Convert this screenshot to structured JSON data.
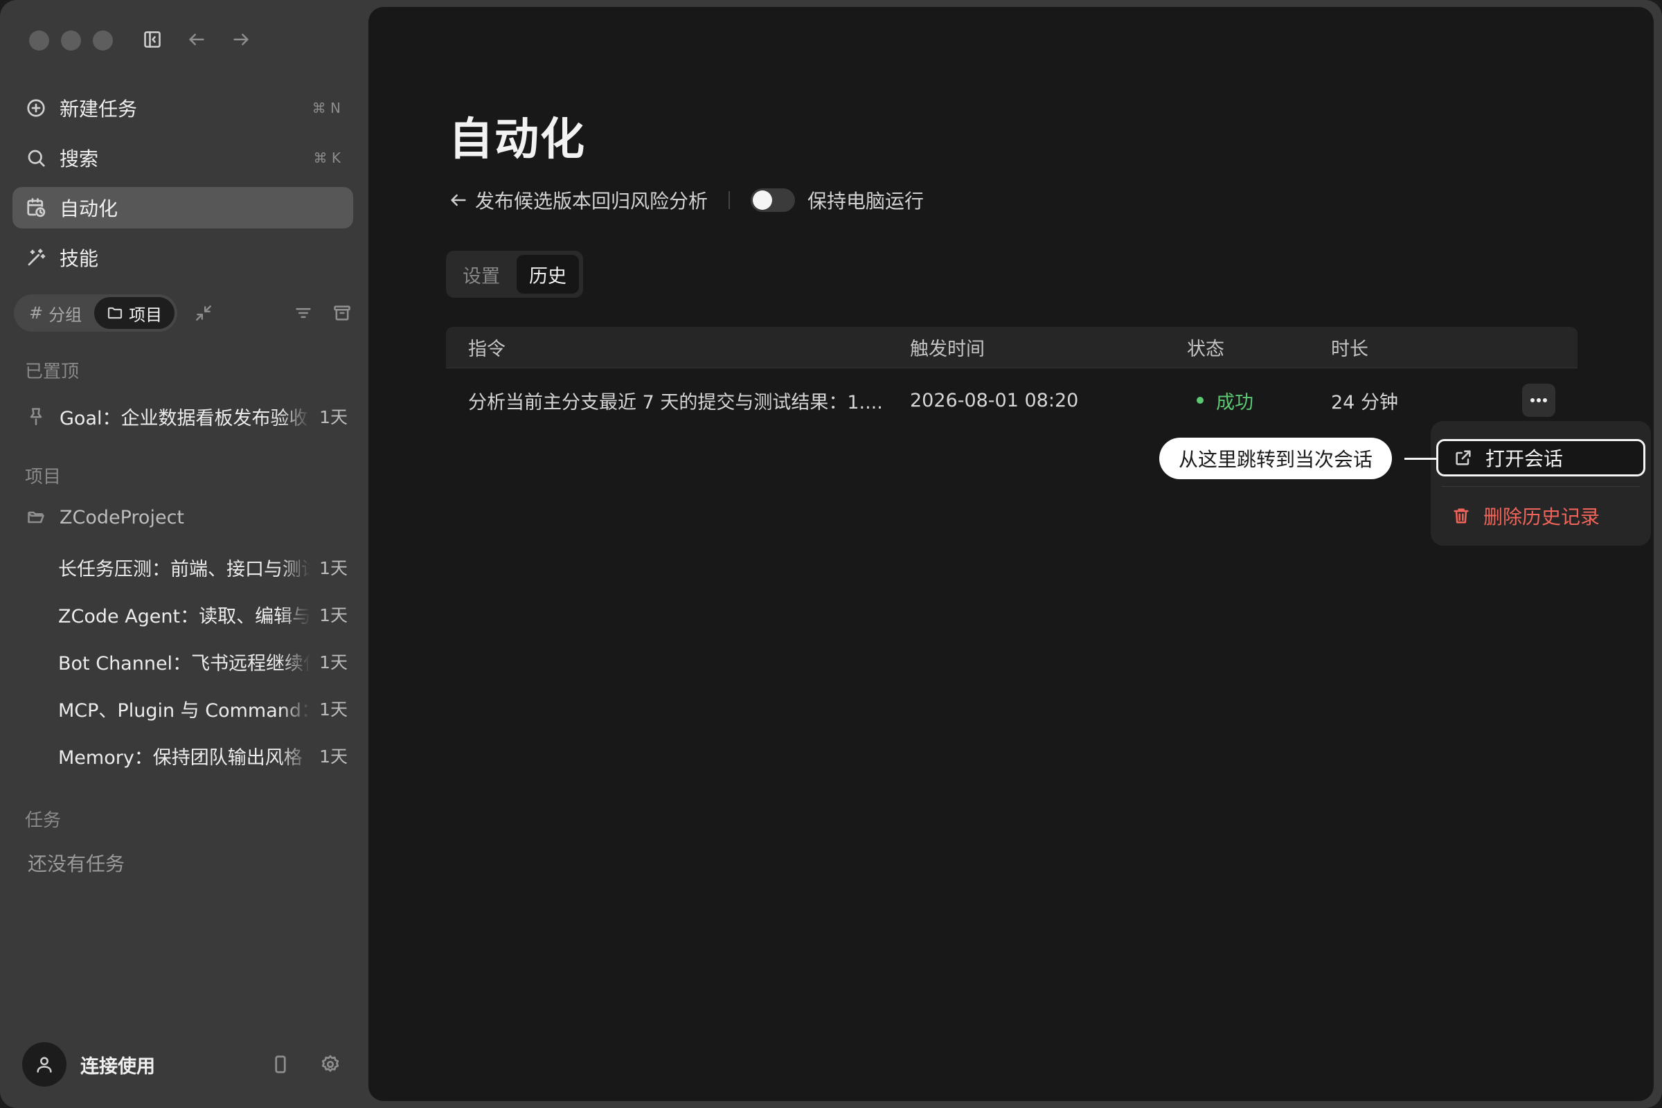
{
  "sidebar": {
    "nav": [
      {
        "label": "新建任务",
        "kbd": "⌘ N",
        "icon": "plus-circle-icon"
      },
      {
        "label": "搜索",
        "kbd": "⌘ K",
        "icon": "search-icon"
      },
      {
        "label": "自动化",
        "kbd": "",
        "icon": "calendar-clock-icon"
      },
      {
        "label": "技能",
        "kbd": "",
        "icon": "magic-wand-icon"
      }
    ],
    "filter": {
      "group": "分组",
      "project": "项目"
    },
    "pinned": {
      "title": "已置顶",
      "items": [
        {
          "label": "Goal：企业数据看板发布验收",
          "ago": "1天"
        }
      ]
    },
    "projects": {
      "title": "项目",
      "folder": "ZCodeProject",
      "items": [
        {
          "label": "长任务压测：前端、接口与测试",
          "ago": "1天"
        },
        {
          "label": "ZCode Agent：读取、编辑与执行",
          "ago": "1天"
        },
        {
          "label": "Bot Channel：飞书远程继续任务",
          "ago": "1天"
        },
        {
          "label": "MCP、Plugin 与 Command：",
          "ago": "1天"
        },
        {
          "label": "Memory：保持团队输出风格",
          "ago": "1天"
        }
      ]
    },
    "tasks": {
      "title": "任务",
      "empty": "还没有任务"
    },
    "footer": {
      "user": "连接使用"
    }
  },
  "main": {
    "title": "自动化",
    "back_label": "发布候选版本回归风险分析",
    "keep_awake": "保持电脑运行",
    "keep_awake_on": false,
    "tabs": [
      {
        "label": "设置",
        "selected": false
      },
      {
        "label": "历史",
        "selected": true
      }
    ],
    "table": {
      "columns": [
        "指令",
        "触发时间",
        "状态",
        "时长"
      ],
      "rows": [
        {
          "command": "分析当前主分支最近 7 天的提交与测试结果：1....",
          "time": "2026-08-01 08:20",
          "status": "成功",
          "duration": "24 分钟"
        }
      ]
    },
    "menu": {
      "open": "打开会话",
      "delete": "删除历史记录"
    },
    "callout": "从这里跳转到当次会话"
  },
  "colors": {
    "success": "#5cc872",
    "danger": "#f0645a",
    "active_nav": "#575757"
  }
}
